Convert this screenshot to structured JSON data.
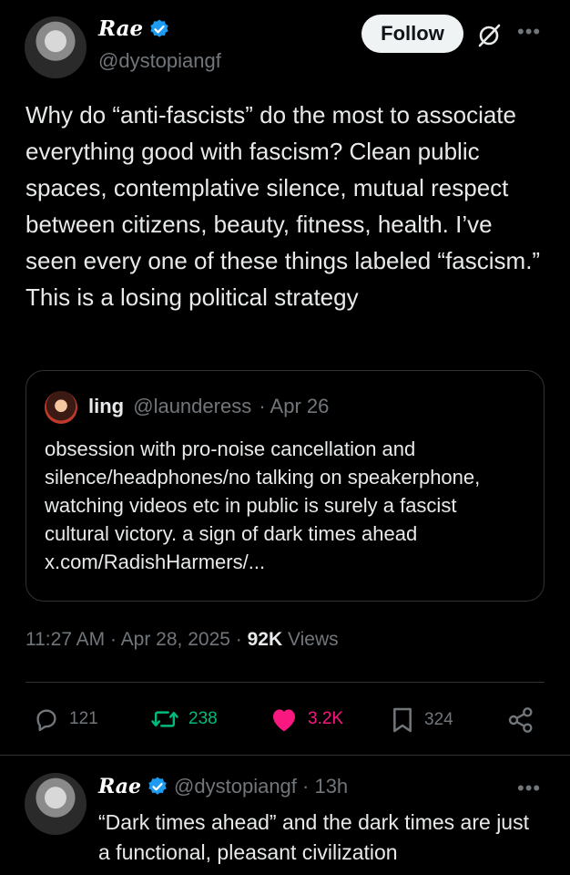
{
  "tweet": {
    "author_name": "Rae",
    "author_handle": "@dystopiangf",
    "follow_label": "Follow",
    "text": "Why do “anti-fascists” do the most to associate everything good with fascism? Clean public spaces, contemplative silence, mutual respect between citizens, beauty, fitness, health. I’ve seen every one of these things labeled “fascism.” This is a losing political strategy",
    "quote": {
      "author_name": "ling",
      "author_handle": "@launderess",
      "date": "· Apr 26",
      "text": "obsession with pro-noise cancellation and silence/headphones/no talking on speakerphone, watching videos etc in public is surely a fascist cultural victory. a sign of dark times ahead x.com/RadishHarmers/..."
    },
    "timestamp": "11:27 AM · Apr 28, 2025 ·",
    "views_count": "92K",
    "views_label": "Views",
    "actions": {
      "replies": "121",
      "reposts": "238",
      "likes": "3.2K",
      "bookmarks": "324"
    }
  },
  "reply": {
    "author_name": "Rae",
    "author_handle": "@dystopiangf · 13h",
    "text": "“Dark times ahead” and the dark times are just a functional, pleasant civilization"
  },
  "colors": {
    "verified": "#1d9bf0",
    "repost_active": "#00ba7c",
    "like_active": "#f91880"
  }
}
